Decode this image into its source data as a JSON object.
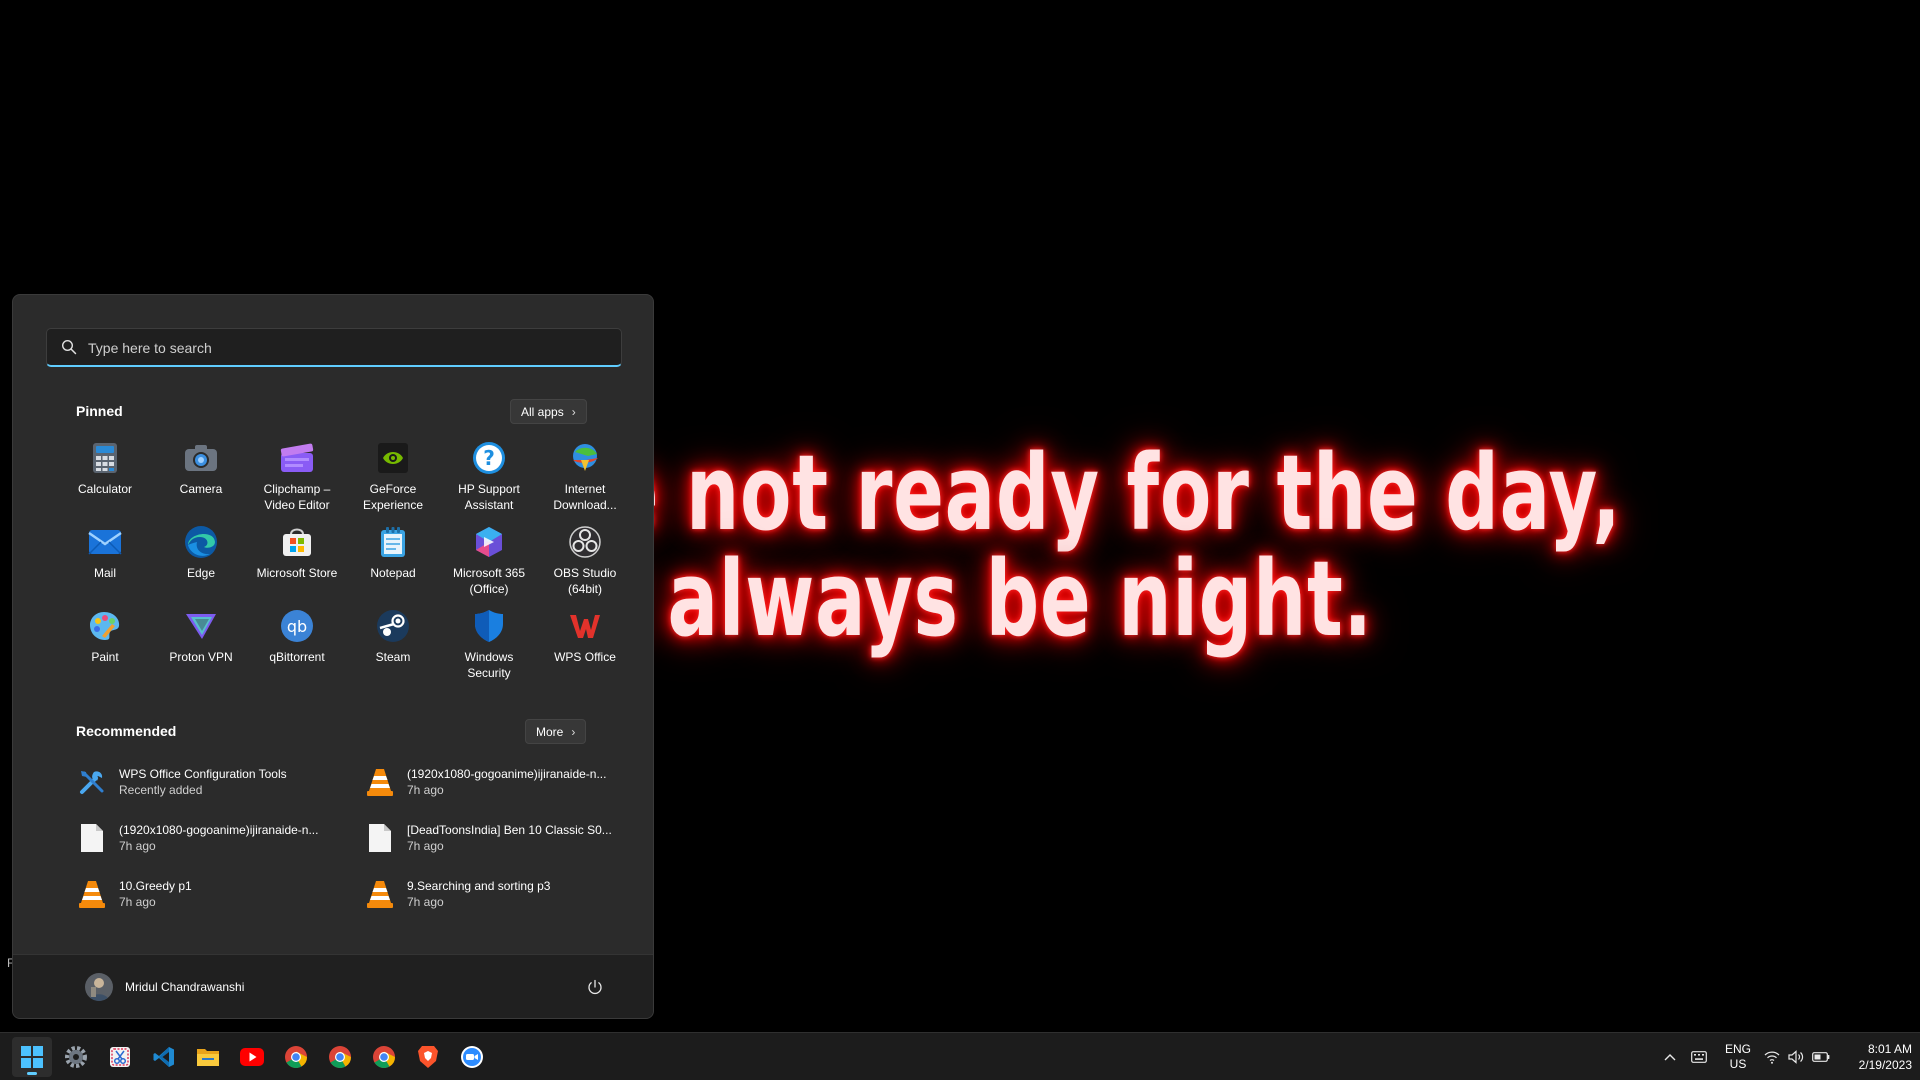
{
  "wallpaper": {
    "quote_line_1": "u are not ready for the day,",
    "quote_line_2": "nnot always be night.",
    "glow_color": "#ff0000",
    "stray_text": "F"
  },
  "start_menu": {
    "search": {
      "placeholder": "Type here to search",
      "value": ""
    },
    "pinned": {
      "title": "Pinned",
      "all_apps_label": "All apps",
      "apps": [
        {
          "label": "Calculator",
          "icon": "calculator-icon"
        },
        {
          "label": "Camera",
          "icon": "camera-icon"
        },
        {
          "label": "Clipchamp – Video Editor",
          "icon": "clipchamp-icon"
        },
        {
          "label": "GeForce Experience",
          "icon": "geforce-icon"
        },
        {
          "label": "HP Support Assistant",
          "icon": "hp-support-icon"
        },
        {
          "label": "Internet Download...",
          "icon": "idm-icon"
        },
        {
          "label": "Mail",
          "icon": "mail-icon"
        },
        {
          "label": "Edge",
          "icon": "edge-icon"
        },
        {
          "label": "Microsoft Store",
          "icon": "store-icon"
        },
        {
          "label": "Notepad",
          "icon": "notepad-icon"
        },
        {
          "label": "Microsoft 365 (Office)",
          "icon": "m365-icon"
        },
        {
          "label": "OBS Studio (64bit)",
          "icon": "obs-icon"
        },
        {
          "label": "Paint",
          "icon": "paint-icon"
        },
        {
          "label": "Proton VPN",
          "icon": "protonvpn-icon"
        },
        {
          "label": "qBittorrent",
          "icon": "qbittorrent-icon"
        },
        {
          "label": "Steam",
          "icon": "steam-icon"
        },
        {
          "label": "Windows Security",
          "icon": "shield-icon"
        },
        {
          "label": "WPS Office",
          "icon": "wps-icon"
        }
      ]
    },
    "recommended": {
      "title": "Recommended",
      "more_label": "More",
      "items": [
        {
          "title": "WPS Office Configuration Tools",
          "subtitle": "Recently added",
          "icon": "tools-icon"
        },
        {
          "title": "(1920x1080-gogoanime)ijiranaide-n...",
          "subtitle": "7h ago",
          "icon": "vlc-icon"
        },
        {
          "title": "(1920x1080-gogoanime)ijiranaide-n...",
          "subtitle": "7h ago",
          "icon": "file-icon"
        },
        {
          "title": "[DeadToonsIndia] Ben 10 Classic S0...",
          "subtitle": "7h ago",
          "icon": "file-icon"
        },
        {
          "title": "10.Greedy p1",
          "subtitle": "7h ago",
          "icon": "vlc-icon"
        },
        {
          "title": "9.Searching and sorting p3",
          "subtitle": "7h ago",
          "icon": "vlc-icon"
        }
      ]
    },
    "user": {
      "name": "Mridul Chandrawanshi"
    }
  },
  "taskbar": {
    "apps": [
      "start-icon",
      "settings-icon",
      "snipping-tool-icon",
      "vscode-icon",
      "file-explorer-icon",
      "youtube-icon",
      "chrome-icon",
      "chrome-icon",
      "chrome-icon",
      "brave-icon",
      "zoom-icon"
    ],
    "language": {
      "line1": "ENG",
      "line2": "US"
    },
    "clock": {
      "time": "8:01 AM",
      "date": "2/19/2023"
    }
  },
  "colors": {
    "accent": "#60cdff",
    "menu_bg": "#2b2b2b",
    "taskbar_bg": "#1c1c1c"
  }
}
